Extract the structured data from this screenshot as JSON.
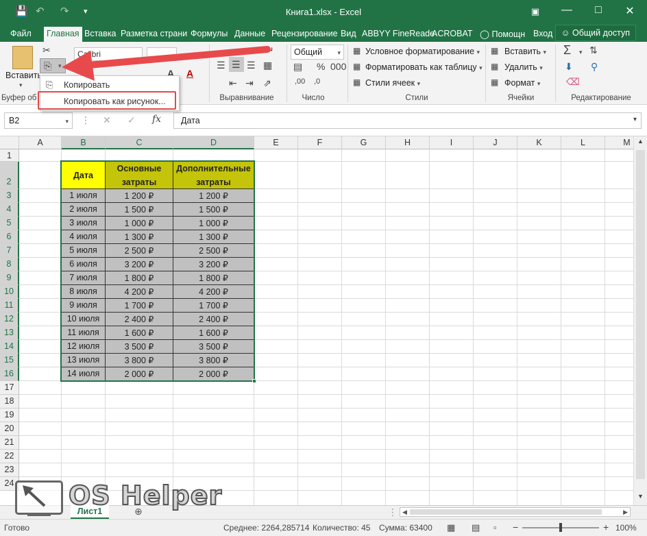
{
  "titlebar": {
    "title": "Книга1.xlsx - Excel"
  },
  "tabs": [
    "Файл",
    "Главная",
    "Вставка",
    "Разметка страни",
    "Формулы",
    "Данные",
    "Рецензирование",
    "Вид",
    "ABBYY FineReade",
    "ACROBAT"
  ],
  "tabs_extra": {
    "help": "Помощн",
    "signin": "Вход",
    "share": "Общий доступ"
  },
  "ribbon": {
    "paste": "Вставить",
    "font_name": "Calibri",
    "number_format": "Общий",
    "cond_format": "Условное форматирование",
    "format_table": "Форматировать как таблицу",
    "cell_styles": "Стили ячеек",
    "insert": "Вставить",
    "delete": "Удалить",
    "format": "Формат",
    "groups": {
      "clipboard": "Буфер об",
      "alignment": "Выравнивание",
      "number": "Число",
      "styles": "Стили",
      "cells": "Ячейки",
      "editing": "Редактирование"
    }
  },
  "menu": {
    "copy": "Копировать",
    "copy_picture": "Копировать как рисунок..."
  },
  "formula_bar": {
    "name_box": "B2",
    "formula": "Дата"
  },
  "columns": [
    "A",
    "B",
    "C",
    "D",
    "E",
    "F",
    "G",
    "H",
    "I",
    "J",
    "K",
    "L",
    "M"
  ],
  "rows": [
    "1",
    "2",
    "3",
    "4",
    "5",
    "6",
    "7",
    "8",
    "9",
    "10",
    "11",
    "12",
    "13",
    "14",
    "15",
    "16",
    "17",
    "18",
    "19",
    "20",
    "21",
    "22",
    "23",
    "24"
  ],
  "table": {
    "headers": [
      "Дата",
      "Основные затраты",
      "Дополнительные затраты"
    ],
    "rows": [
      [
        "1 июля",
        "1 200 ₽",
        "1 200 ₽"
      ],
      [
        "2 июля",
        "1 500 ₽",
        "1 500 ₽"
      ],
      [
        "3 июля",
        "1 000 ₽",
        "1 000 ₽"
      ],
      [
        "4 июля",
        "1 300 ₽",
        "1 300 ₽"
      ],
      [
        "5 июля",
        "2 500 ₽",
        "2 500 ₽"
      ],
      [
        "6 июля",
        "3 200 ₽",
        "3 200 ₽"
      ],
      [
        "7 июля",
        "1 800 ₽",
        "1 800 ₽"
      ],
      [
        "8 июля",
        "4 200 ₽",
        "4 200 ₽"
      ],
      [
        "9 июля",
        "1 700 ₽",
        "1 700 ₽"
      ],
      [
        "10 июля",
        "2 400 ₽",
        "2 400 ₽"
      ],
      [
        "11 июля",
        "1 600 ₽",
        "1 600 ₽"
      ],
      [
        "12 июля",
        "3 500 ₽",
        "3 500 ₽"
      ],
      [
        "13 июля",
        "3 800 ₽",
        "3 800 ₽"
      ],
      [
        "14 июля",
        "2 000 ₽",
        "2 000 ₽"
      ]
    ]
  },
  "sheet_tab": "Лист1",
  "watermark": "OS Helper",
  "status": {
    "ready": "Готово",
    "average": "Среднее: 2264,285714",
    "count": "Количество: 45",
    "sum": "Сумма: 63400",
    "zoom": "100%"
  },
  "colors": {
    "excel_green": "#217346",
    "header_yellow": "#ffff00",
    "header_olive": "#c4c40a",
    "data_gray": "#c0c0c0",
    "arrow_red": "#e8494b"
  }
}
